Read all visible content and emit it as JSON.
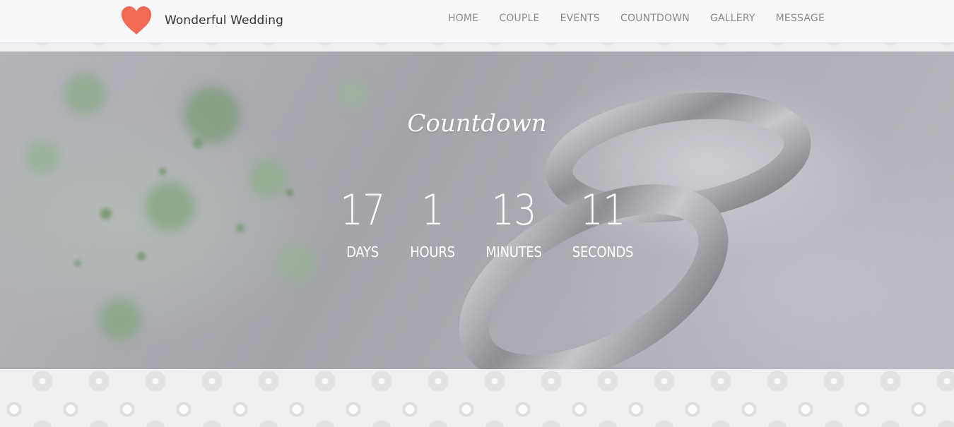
{
  "navbar": {
    "brand_name": "Wonderful Wedding",
    "brand_icon": "heart-icon",
    "brand_color": "#f26a54",
    "items": [
      {
        "label": "HOME"
      },
      {
        "label": "COUPLE"
      },
      {
        "label": "EVENTS"
      },
      {
        "label": "COUNTDOWN"
      },
      {
        "label": "GALLERY"
      },
      {
        "label": "MESSAGE"
      }
    ]
  },
  "hero": {
    "title": "Countdown",
    "countdown": [
      {
        "value": "17",
        "label": "DAYS"
      },
      {
        "value": "1",
        "label": "HOURS"
      },
      {
        "value": "13",
        "label": "MINUTES"
      },
      {
        "value": "11",
        "label": "SECONDS"
      }
    ]
  }
}
